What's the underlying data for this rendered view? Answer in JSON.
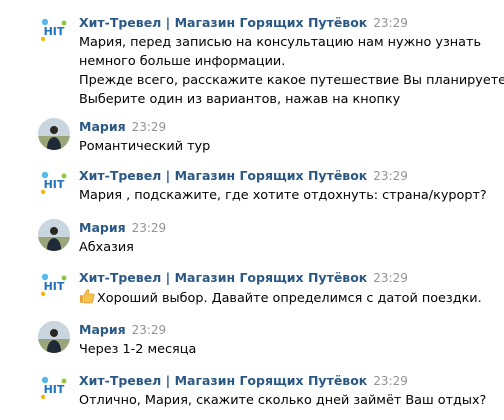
{
  "bot_name": "Хит-Тревел | Магазин Горящих Путёвок",
  "user_name": "Мария",
  "messages": [
    {
      "sender": "Хит-Тревел | Магазин Горящих Путёвок",
      "time": "23:29",
      "lines": [
        "Мария, перед записью на консультацию нам нужно узнать",
        "немного больше информации.",
        "Прежде всего, расскажите какое путешествие Вы планируете?",
        "Выберите один из вариантов, нажав на кнопку"
      ]
    },
    {
      "sender": "Мария",
      "time": "23:29",
      "lines": [
        "Романтический тур"
      ]
    },
    {
      "sender": "Хит-Тревел | Магазин Горящих Путёвок",
      "time": "23:29",
      "lines": [
        "Мария , подскажите, где хотите отдохнуть: страна/курорт?"
      ]
    },
    {
      "sender": "Мария",
      "time": "23:29",
      "lines": [
        "Абхазия"
      ]
    },
    {
      "sender": "Хит-Тревел | Магазин Горящих Путёвок",
      "time": "23:29",
      "lines": [
        "Хороший выбор. Давайте определимся с датой поездки."
      ]
    },
    {
      "sender": "Мария",
      "time": "23:29",
      "lines": [
        "Через 1-2 месяца"
      ]
    },
    {
      "sender": "Хит-Тревел | Магазин Горящих Путёвок",
      "time": "23:29",
      "lines": [
        "Отлично, Мария, скажите сколько дней займёт Ваш отдых?"
      ]
    }
  ],
  "avatar_logo_text": "HIT",
  "colors": {
    "sender_name": "#2a5885",
    "timestamp": "#939393",
    "text": "#000000"
  }
}
